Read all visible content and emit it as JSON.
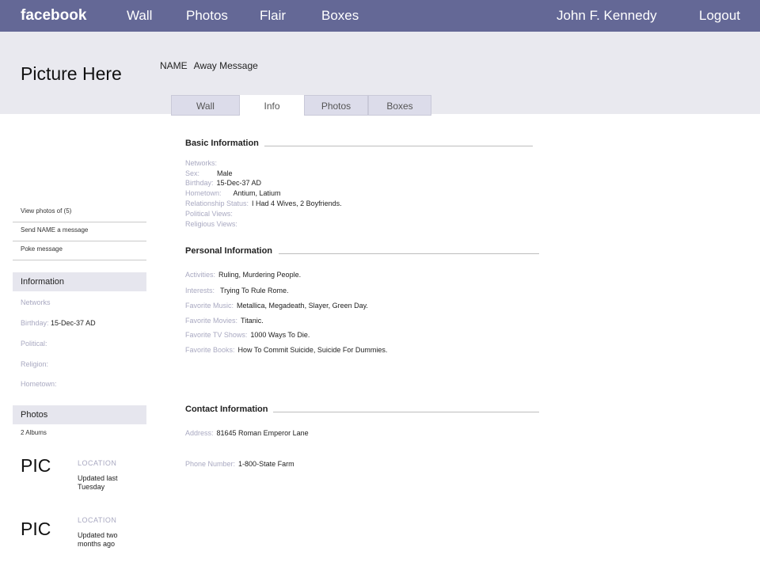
{
  "nav": {
    "logo": "facebook",
    "links": [
      "Wall",
      "Photos",
      "Flair",
      "Boxes"
    ],
    "user": "John F. Kennedy",
    "logout": "Logout"
  },
  "profile": {
    "picture_placeholder": "Picture Here",
    "name": "NAME",
    "away_message": "Away Message"
  },
  "tabs": [
    "Wall",
    "Info",
    "Photos",
    "Boxes"
  ],
  "active_tab": "Info",
  "sidebar": {
    "links": [
      "View photos of  (5)",
      "Send NAME  a message",
      "Poke message"
    ],
    "info_header": "Information",
    "info_rows": [
      {
        "label": "Networks",
        "value": ""
      },
      {
        "label": "Birthday:",
        "value": "15-Dec-37 AD"
      },
      {
        "label": "Political:",
        "value": ""
      },
      {
        "label": "Religion:",
        "value": ""
      },
      {
        "label": "Hometown:",
        "value": ""
      }
    ],
    "photos_header": "Photos",
    "albums": "2 Albums",
    "photo_items": [
      {
        "pic": "PIC",
        "location": "LOCATION",
        "updated": "Updated last Tuesday"
      },
      {
        "pic": "PIC",
        "location": "LOCATION",
        "updated": "Updated two months ago"
      }
    ]
  },
  "basic": {
    "title": "Basic Information",
    "fields": [
      {
        "label": "Networks:",
        "value": ""
      },
      {
        "label": "Sex:",
        "value": "Male"
      },
      {
        "label": "Birthday:",
        "value": "15-Dec-37 AD"
      },
      {
        "label": "Hometown:",
        "value": "Antium, Latium"
      },
      {
        "label": "Relationship Status:",
        "value": "I Had 4 Wives, 2 Boyfriends."
      },
      {
        "label": "Political Views:",
        "value": ""
      },
      {
        "label": "Religious Views:",
        "value": ""
      }
    ]
  },
  "personal": {
    "title": "Personal Information",
    "fields": [
      {
        "label": "Activities:",
        "value": "Ruling, Murdering People."
      },
      {
        "label": "Interests:",
        "value": "Trying To Rule Rome."
      },
      {
        "label": "Favorite Music:",
        "value": "Metallica, Megadeath, Slayer, Green Day."
      },
      {
        "label": "Favorite Movies:",
        "value": "Titanic."
      },
      {
        "label": "Favorite TV Shows:",
        "value": "1000 Ways To Die."
      },
      {
        "label": "Favorite Books:",
        "value": "How To Commit Suicide, Suicide For Dummies."
      }
    ]
  },
  "contact": {
    "title": "Contact Information",
    "fields": [
      {
        "label": "Address:",
        "value": "81645 Roman Emperor Lane"
      },
      {
        "label": "Phone Number:",
        "value": "1-800-State Farm"
      }
    ]
  }
}
